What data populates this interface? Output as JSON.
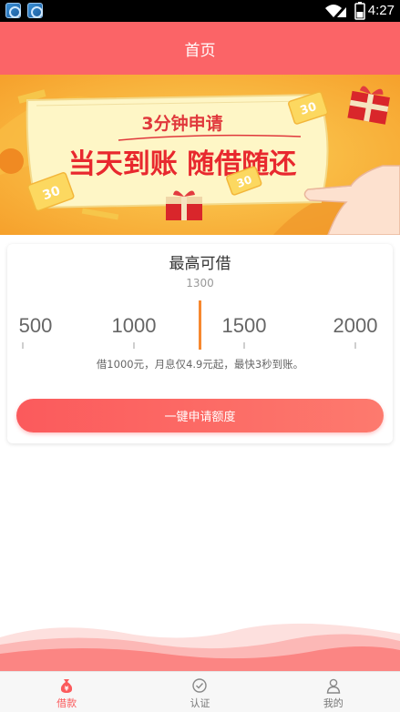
{
  "status_bar": {
    "time": "4:27",
    "battery": "2"
  },
  "header": {
    "title": "首页"
  },
  "banner": {
    "headline_small": "3分钟申请",
    "headline_big": "当天到账 随借随还",
    "coupon_value": "30"
  },
  "loan_card": {
    "title": "最高可借",
    "amount": "1300",
    "scale_labels": [
      "500",
      "1000",
      "1500",
      "2000"
    ],
    "hint": "借1000元，月息仅4.9元起，最快3秒到账。",
    "apply_button": "一键申请额度"
  },
  "tabbar": {
    "items": [
      {
        "label": "借款",
        "icon": "money-bag-icon",
        "active": true
      },
      {
        "label": "认证",
        "icon": "verify-check-icon",
        "active": false
      },
      {
        "label": "我的",
        "icon": "person-icon",
        "active": false
      }
    ]
  },
  "colors": {
    "primary": "#fb6467",
    "accent_orange": "#f7882f",
    "banner_yellow": "#f9b23a"
  }
}
